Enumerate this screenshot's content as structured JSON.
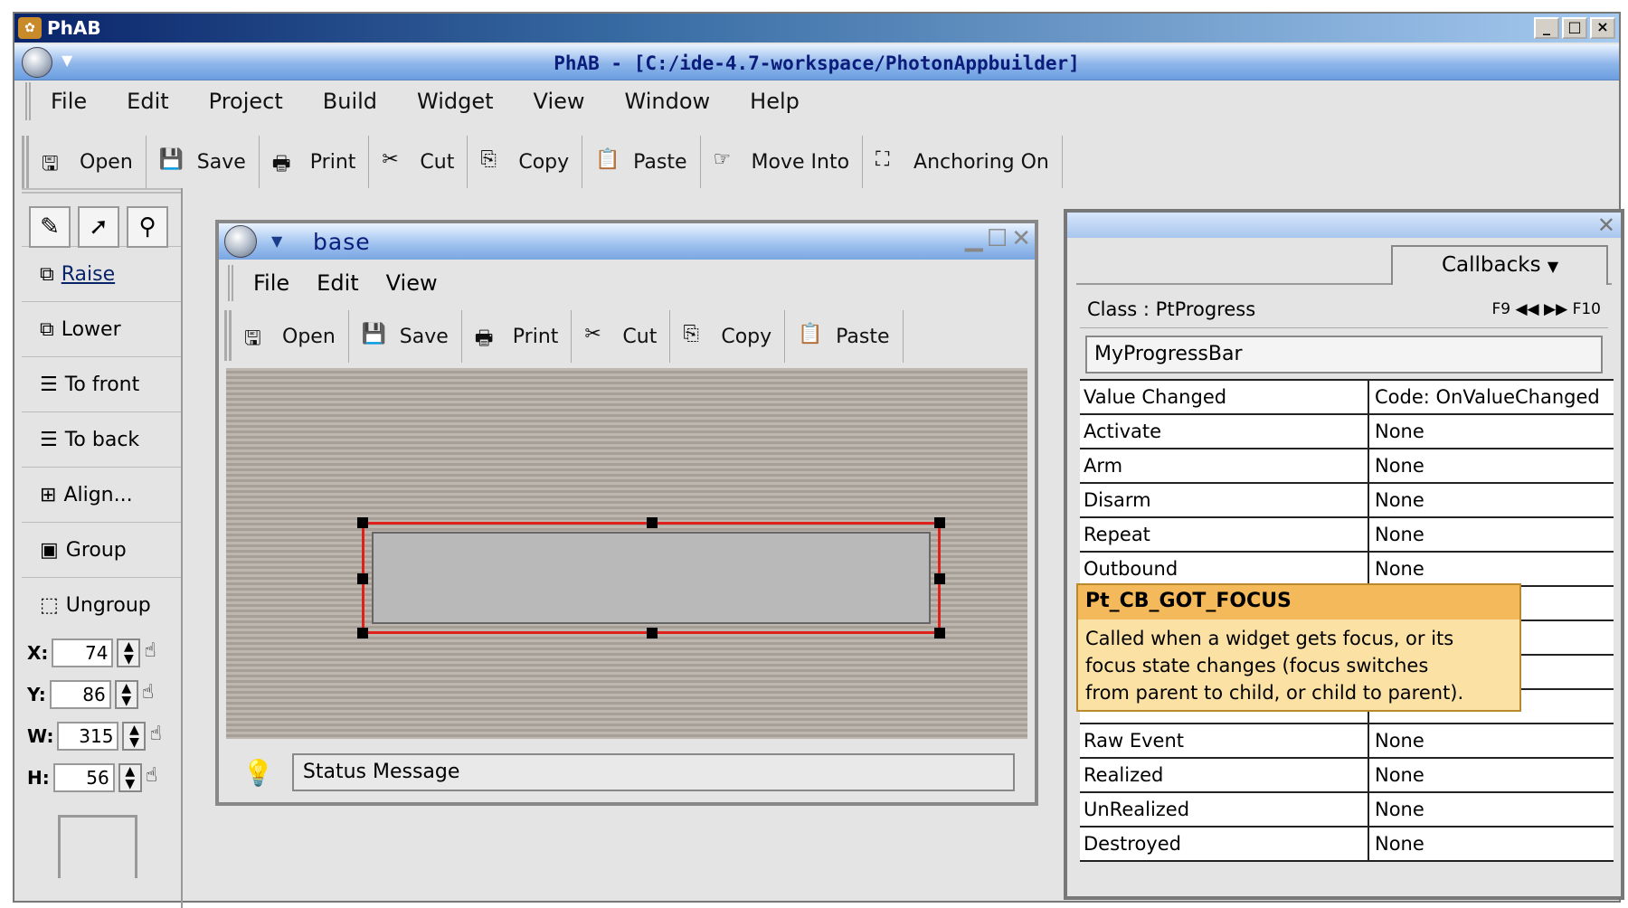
{
  "window": {
    "title": "PhAB",
    "btn_min": "_",
    "btn_max": "□",
    "btn_close": "×"
  },
  "photon": {
    "title": "PhAB - [C:/ide-4.7-workspace/PhotonAppbuilder]"
  },
  "menu": [
    "File",
    "Edit",
    "Project",
    "Build",
    "Widget",
    "View",
    "Window",
    "Help"
  ],
  "toolbar": {
    "open": "Open",
    "save": "Save",
    "print": "Print",
    "cut": "Cut",
    "copy": "Copy",
    "paste": "Paste",
    "move_into": "Move Into",
    "anchoring": "Anchoring On"
  },
  "left": {
    "raise": "Raise",
    "lower": "Lower",
    "to_front": "To front",
    "to_back": "To back",
    "align": "Align...",
    "group": "Group",
    "ungroup": "Ungroup",
    "x_label": "X:",
    "x_value": "74",
    "y_label": "Y:",
    "y_value": "86",
    "w_label": "W:",
    "w_value": "315",
    "h_label": "H:",
    "h_value": "56"
  },
  "base": {
    "title": "base",
    "menu": [
      "File",
      "Edit",
      "View"
    ],
    "toolbar": {
      "open": "Open",
      "save": "Save",
      "print": "Print",
      "cut": "Cut",
      "copy": "Copy",
      "paste": "Paste"
    },
    "status": "Status Message"
  },
  "panel": {
    "tab": "Callbacks",
    "class_label": "Class : PtProgress",
    "nav_prev": "F9",
    "nav_next": "F10",
    "name": "MyProgressBar",
    "rows": [
      {
        "name": "Value Changed",
        "value": "Code: OnValueChanged"
      },
      {
        "name": "Activate",
        "value": "None"
      },
      {
        "name": "Arm",
        "value": "None"
      },
      {
        "name": "Disarm",
        "value": "None"
      },
      {
        "name": "Repeat",
        "value": "None"
      },
      {
        "name": "Outbound",
        "value": "None"
      },
      {
        "name": "",
        "value": ""
      },
      {
        "name": "",
        "value": ""
      },
      {
        "name": "",
        "value": ""
      },
      {
        "name": "",
        "value": ""
      },
      {
        "name": "Raw Event",
        "value": "None"
      },
      {
        "name": "Realized",
        "value": "None"
      },
      {
        "name": "UnRealized",
        "value": "None"
      },
      {
        "name": "Destroyed",
        "value": "None"
      }
    ]
  },
  "tooltip": {
    "title": "Pt_CB_GOT_FOCUS",
    "lines": [
      "Called when a widget gets focus, or its",
      "focus state changes (focus switches",
      "from parent to child, or child to parent)."
    ]
  }
}
